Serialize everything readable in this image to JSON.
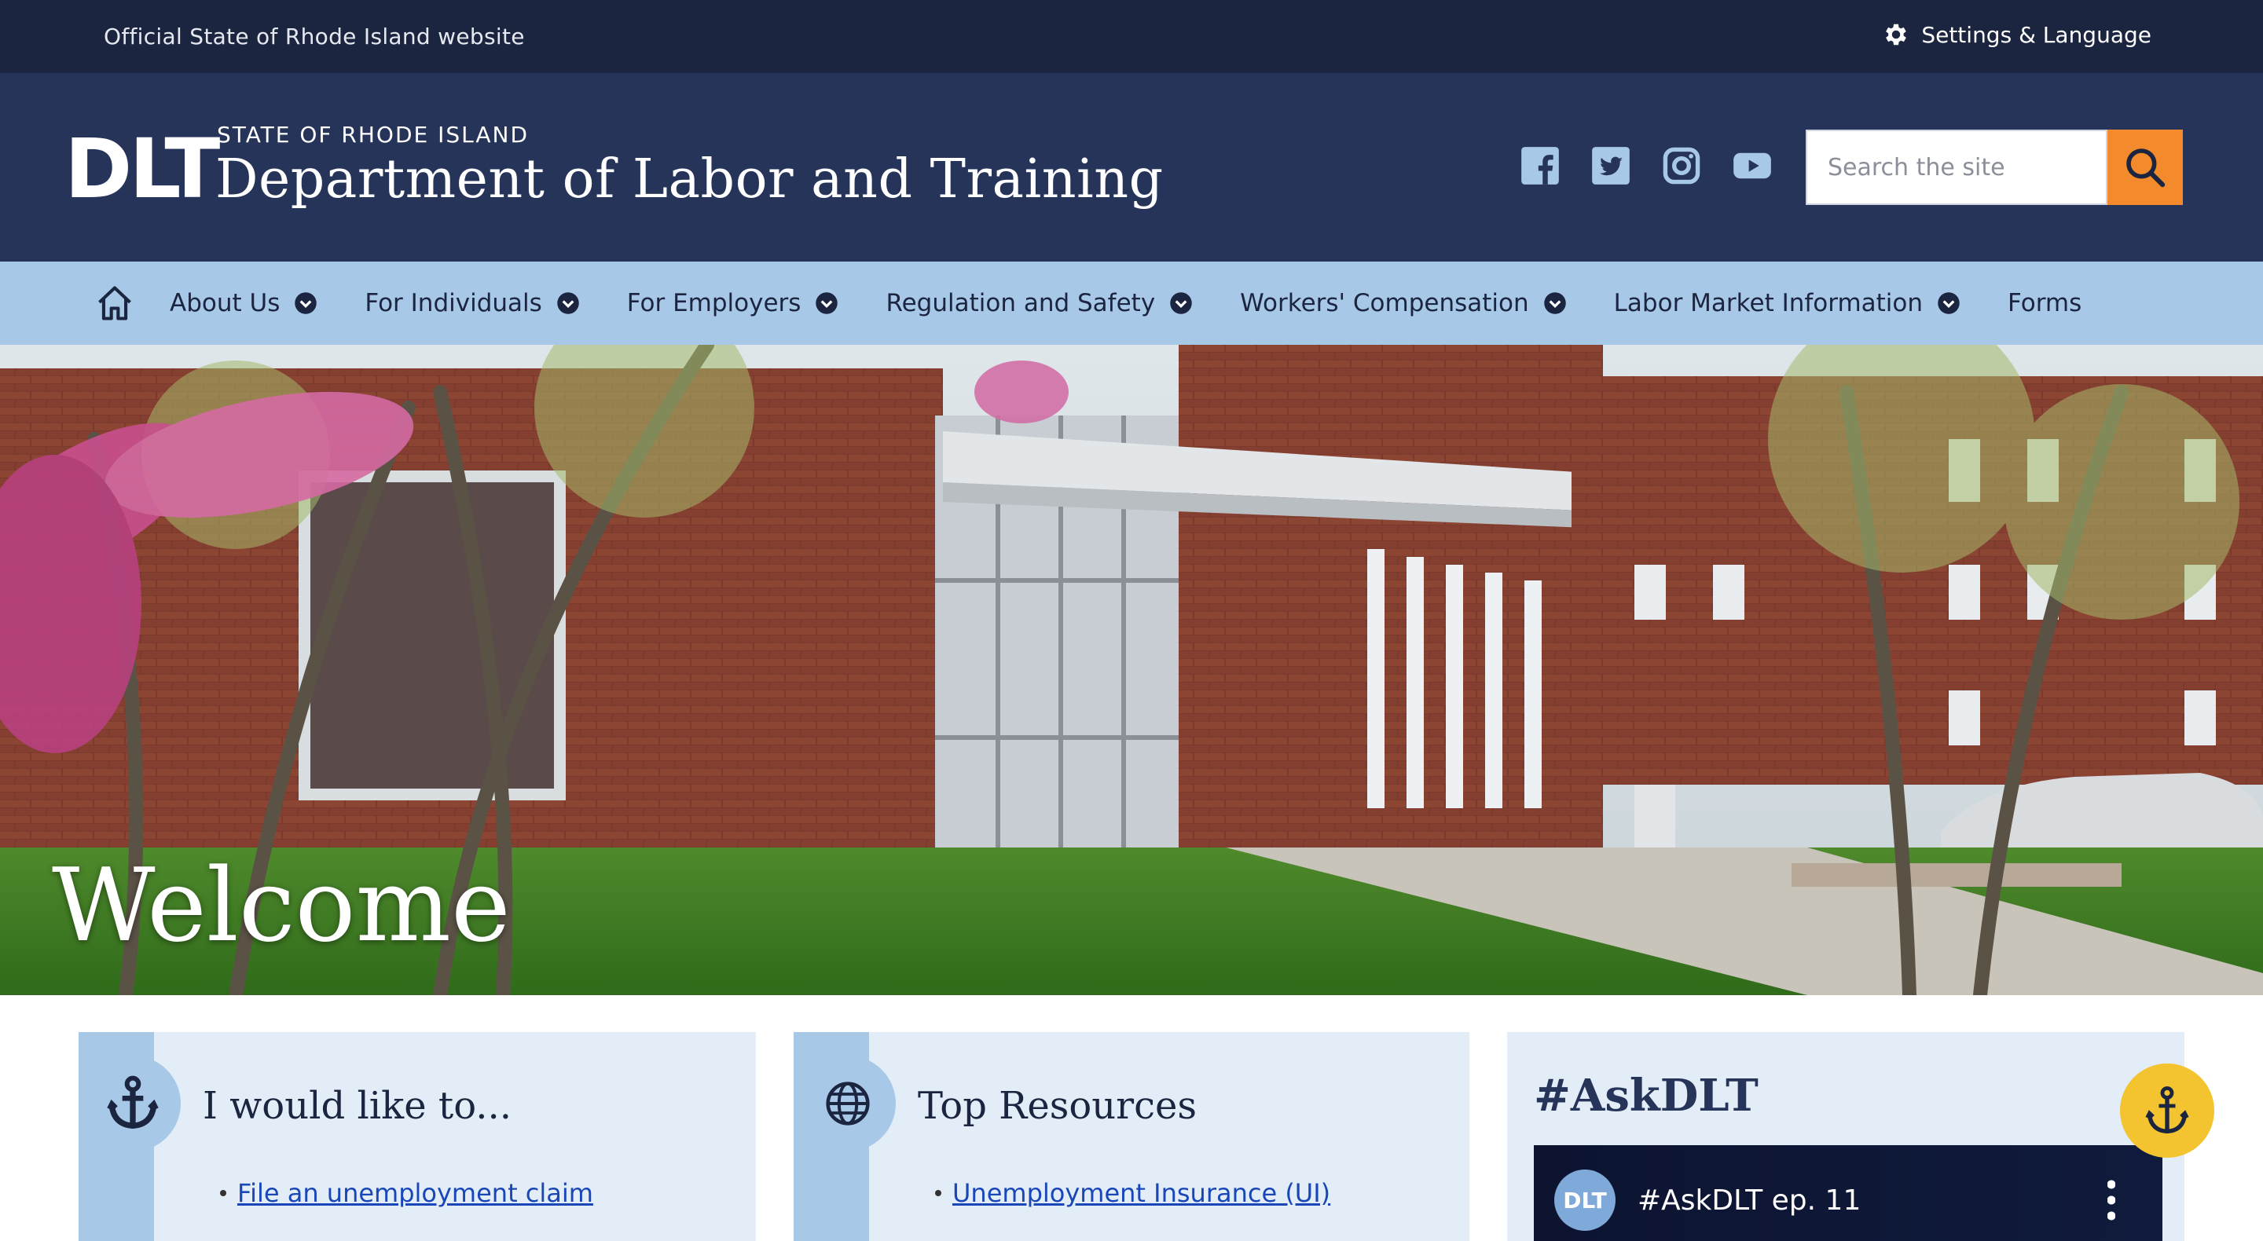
{
  "topbar": {
    "official_text": "Official State of Rhode Island website",
    "settings_label": "Settings & Language"
  },
  "header": {
    "logo_text": "DLT",
    "state_label": "STATE OF RHODE ISLAND",
    "dept_title": "Department of Labor and Training",
    "social_icons": [
      "facebook-icon",
      "twitter-icon",
      "instagram-icon",
      "youtube-icon"
    ],
    "search": {
      "placeholder": "Search the site",
      "value": ""
    }
  },
  "nav": {
    "items": [
      {
        "label": "About Us",
        "has_dropdown": true
      },
      {
        "label": "For Individuals",
        "has_dropdown": true
      },
      {
        "label": "For Employers",
        "has_dropdown": true
      },
      {
        "label": "Regulation and Safety",
        "has_dropdown": true
      },
      {
        "label": "Workers' Compensation",
        "has_dropdown": true
      },
      {
        "label": "Labor Market Information",
        "has_dropdown": true
      },
      {
        "label": "Forms",
        "has_dropdown": false
      }
    ]
  },
  "hero": {
    "heading": "Welcome"
  },
  "cards": [
    {
      "title": "I would like to...",
      "icon": "anchor-icon",
      "links": [
        "File an unemployment claim"
      ]
    },
    {
      "title": "Top Resources",
      "icon": "globe-icon",
      "links": [
        "Unemployment Insurance (UI)"
      ]
    },
    {
      "title": "#AskDLT",
      "video": {
        "avatar_text": "DLT",
        "title": "#AskDLT ep. 11"
      }
    }
  ],
  "colors": {
    "topbar_bg": "#1c2540",
    "header_bg": "#263459",
    "nav_bg": "#a8c8e8",
    "search_button": "#f38b2c",
    "card_bg": "#e3edf7",
    "fab": "#f4c430",
    "link": "#1947b8"
  }
}
